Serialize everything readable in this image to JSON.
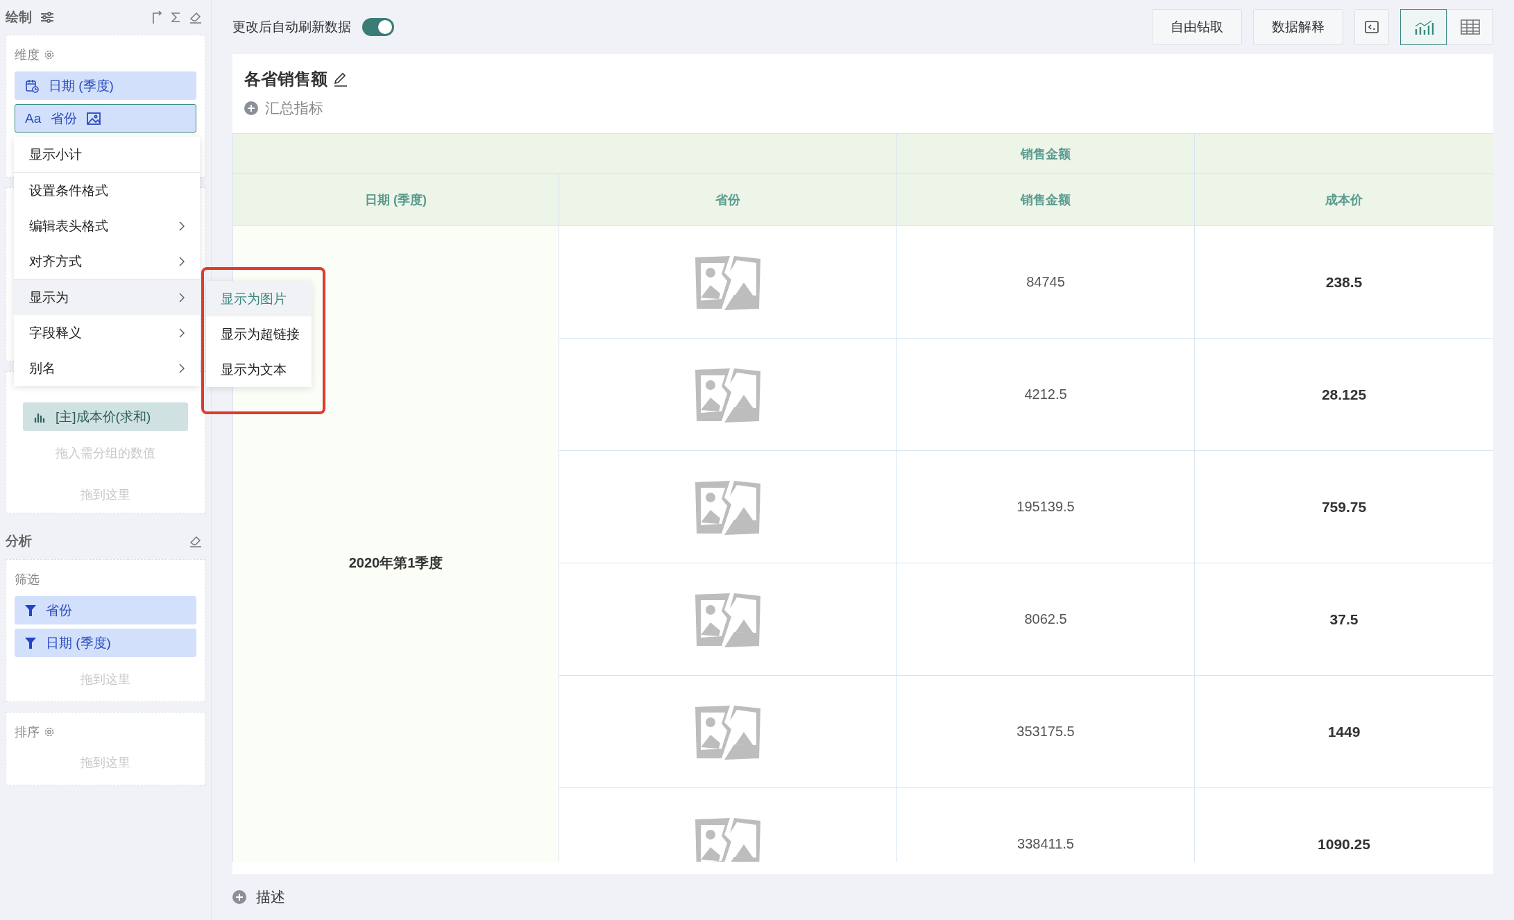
{
  "sidebar": {
    "draw_title": "绘制",
    "dimensions": {
      "title": "维度",
      "fields": [
        {
          "kind": "date",
          "label": "日期 (季度)",
          "selected": false
        },
        {
          "kind": "text",
          "glyph": "Aa",
          "label": "省份",
          "selected": true
        }
      ]
    },
    "metric_group": {
      "fields": [
        "[主]成本价(求和)"
      ],
      "placeholder": "拖入需分组的数值",
      "drop_hint": "拖到这里"
    },
    "analysis": {
      "title": "分析",
      "filter": {
        "title": "筛选",
        "fields": [
          "省份",
          "日期 (季度)"
        ],
        "drop_hint": "拖到这里"
      },
      "sort": {
        "title": "排序",
        "drop_hint": "拖到这里"
      }
    }
  },
  "context_menu": {
    "items": [
      {
        "label": "显示小计",
        "submenu": false,
        "selected": false
      },
      {
        "label": "设置条件格式",
        "submenu": false,
        "selected": false
      },
      {
        "label": "编辑表头格式",
        "submenu": true,
        "selected": false
      },
      {
        "label": "对齐方式",
        "submenu": true,
        "selected": false
      },
      {
        "label": "显示为",
        "submenu": true,
        "selected": true
      },
      {
        "label": "字段释义",
        "submenu": true,
        "selected": false
      },
      {
        "label": "别名",
        "submenu": true,
        "selected": false
      }
    ],
    "submenu": [
      {
        "label": "显示为图片",
        "selected": true
      },
      {
        "label": "显示为超链接",
        "selected": false
      },
      {
        "label": "显示为文本",
        "selected": false
      }
    ]
  },
  "toolbar": {
    "auto_refresh_label": "更改后自动刷新数据",
    "auto_refresh_on": true,
    "buttons": [
      "自由钻取",
      "数据解释"
    ],
    "view_modes": [
      {
        "kind": "chart",
        "selected": true
      },
      {
        "kind": "table",
        "selected": false
      }
    ]
  },
  "chart_card": {
    "title": "各省销售额",
    "summary_label": "汇总指标",
    "table": {
      "group_header": "销售金额",
      "columns": [
        "日期 (季度)",
        "省份",
        "销售金额",
        "成本价"
      ],
      "date_cell": "2020年第1季度",
      "rows": [
        {
          "sales": "84745",
          "cost": "238.5"
        },
        {
          "sales": "4212.5",
          "cost": "28.125"
        },
        {
          "sales": "195139.5",
          "cost": "759.75"
        },
        {
          "sales": "8062.5",
          "cost": "37.5"
        },
        {
          "sales": "353175.5",
          "cost": "1449"
        },
        {
          "sales": "338411.5",
          "cost": "1090.25"
        }
      ]
    }
  },
  "description_label": "描述"
}
